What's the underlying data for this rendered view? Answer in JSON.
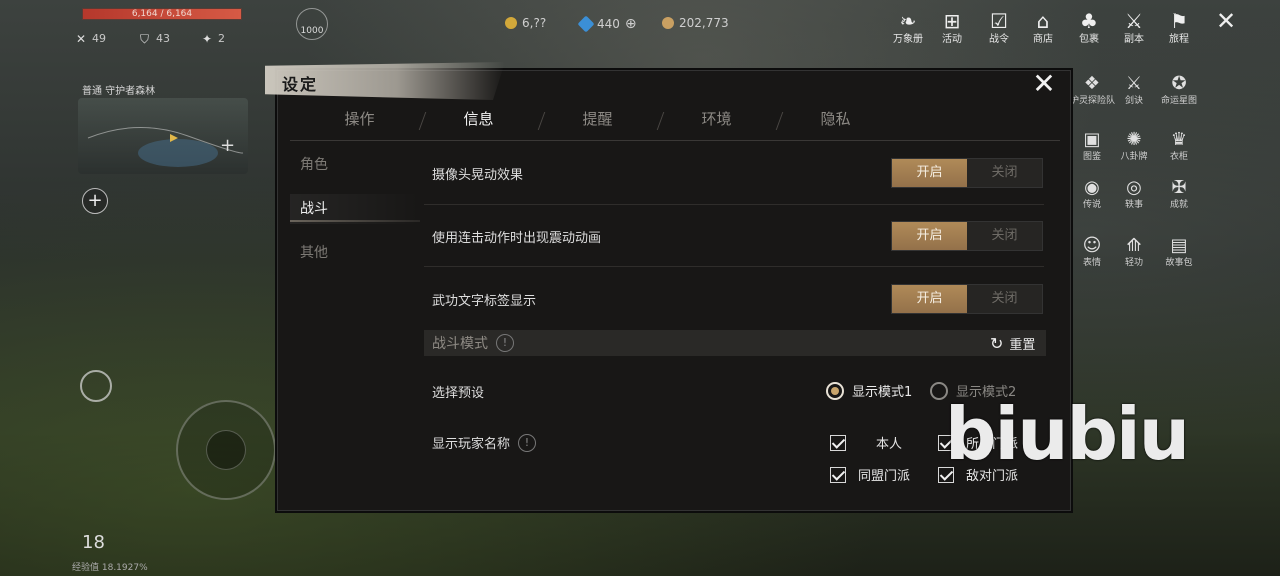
{
  "hud": {
    "hp_text": "6,164 / 6,164",
    "stats": [
      "49",
      "43",
      "2"
    ],
    "level": "1000",
    "currencies": [
      "6,??",
      "440",
      "202,773"
    ],
    "map_region": "普通  守护者森林",
    "bottom_level": "18",
    "exp_text": "经验值 18.1927%"
  },
  "top_menu": [
    {
      "icon": "book-icon",
      "label": "万象册"
    },
    {
      "icon": "gift-icon",
      "label": "活动"
    },
    {
      "icon": "pass-icon",
      "label": "战令"
    },
    {
      "icon": "shop-icon",
      "label": "商店"
    },
    {
      "icon": "bag-icon",
      "label": "包裹"
    },
    {
      "icon": "dungeon-icon",
      "label": "副本"
    },
    {
      "icon": "flag-icon",
      "label": "旅程"
    }
  ],
  "side_menu": [
    {
      "icon": "escort-icon",
      "label": "护灵探险队"
    },
    {
      "icon": "sword-icon",
      "label": "剑诀"
    },
    {
      "icon": "fate-icon",
      "label": "命运星图"
    },
    {
      "icon": "codex-icon",
      "label": "图鉴"
    },
    {
      "icon": "bagua-icon",
      "label": "八卦牌"
    },
    {
      "icon": "wardrobe-icon",
      "label": "衣柜"
    },
    {
      "icon": "legend-icon",
      "label": "传说"
    },
    {
      "icon": "anecdote-icon",
      "label": "轶事"
    },
    {
      "icon": "achievement-icon",
      "label": "成就"
    },
    {
      "icon": "emote-icon",
      "label": "表情"
    },
    {
      "icon": "lightfoot-icon",
      "label": "轻功"
    },
    {
      "icon": "storybook-icon",
      "label": "故事包"
    }
  ],
  "dialog": {
    "title": "设定",
    "tabs": [
      "操作",
      "信息",
      "提醒",
      "环境",
      "隐私"
    ],
    "active_tab": "信息",
    "nav": [
      "角色",
      "战斗",
      "其他"
    ],
    "active_nav": "战斗",
    "rows": [
      {
        "label": "摄像头晃动效果",
        "on": "开启",
        "off": "关闭"
      },
      {
        "label": "使用连击动作时出现震动动画",
        "on": "开启",
        "off": "关闭"
      },
      {
        "label": "武功文字标签显示",
        "on": "开启",
        "off": "关闭"
      }
    ],
    "section_title": "战斗模式",
    "reset_label": "重置",
    "preset_label": "选择预设",
    "preset_options": [
      "显示模式1",
      "显示模式2"
    ],
    "preset_selected": "显示模式1",
    "names_label": "显示玩家名称",
    "name_checks": [
      "本人",
      "所属门派",
      "同盟门派",
      "敌对门派"
    ]
  },
  "watermark": "biubiu",
  "colors": {
    "toggle_on": "#a8834f",
    "dialog_bg": "#181716",
    "radio_selected": "#c9a56c"
  }
}
